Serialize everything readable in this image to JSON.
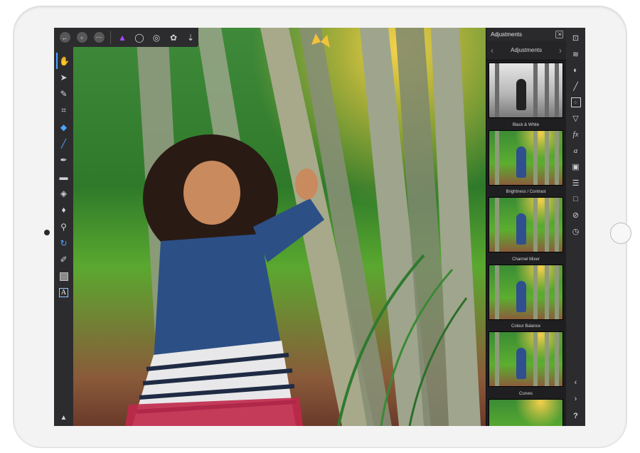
{
  "panel": {
    "title": "Adjustments",
    "nav_label": "Adjustments",
    "presets": [
      {
        "label": "Black & White"
      },
      {
        "label": "Brightness / Contrast"
      },
      {
        "label": "Channel Mixer"
      },
      {
        "label": "Colour Balance"
      },
      {
        "label": "Curves"
      }
    ]
  },
  "left_toolbar": {
    "bottom_glyph": "▲"
  },
  "studio": {
    "help_label": "?"
  },
  "icons": {
    "top": [
      "back-icon",
      "document-icon",
      "more-icon",
      "persona-photo-icon",
      "selection-lasso-icon",
      "liquify-icon",
      "develop-icon",
      "export-icon"
    ],
    "left": [
      "hand-icon",
      "move-icon",
      "color-picker-icon",
      "crop-icon",
      "selection-brush-icon",
      "paint-brush-icon",
      "pen-brush-icon",
      "eraser-icon",
      "fill-icon",
      "dodge-icon",
      "clone-icon",
      "redeye-icon",
      "blur-icon",
      "rectangle-swatch-icon",
      "text-icon"
    ],
    "studio": [
      "navigator-icon",
      "layers-icon",
      "channels-icon",
      "brushes-icon",
      "adjustments-icon",
      "filters-icon",
      "effects-icon",
      "styles-icon",
      "camera-icon",
      "settings-icon",
      "transform-icon",
      "blocked-icon",
      "history-icon"
    ]
  },
  "colors": {
    "panel_bg": "#1f1f21",
    "toolbar_bg": "#2c2c2e",
    "accent_blue": "#4fa3ff",
    "accent_purple": "#a64dff"
  }
}
